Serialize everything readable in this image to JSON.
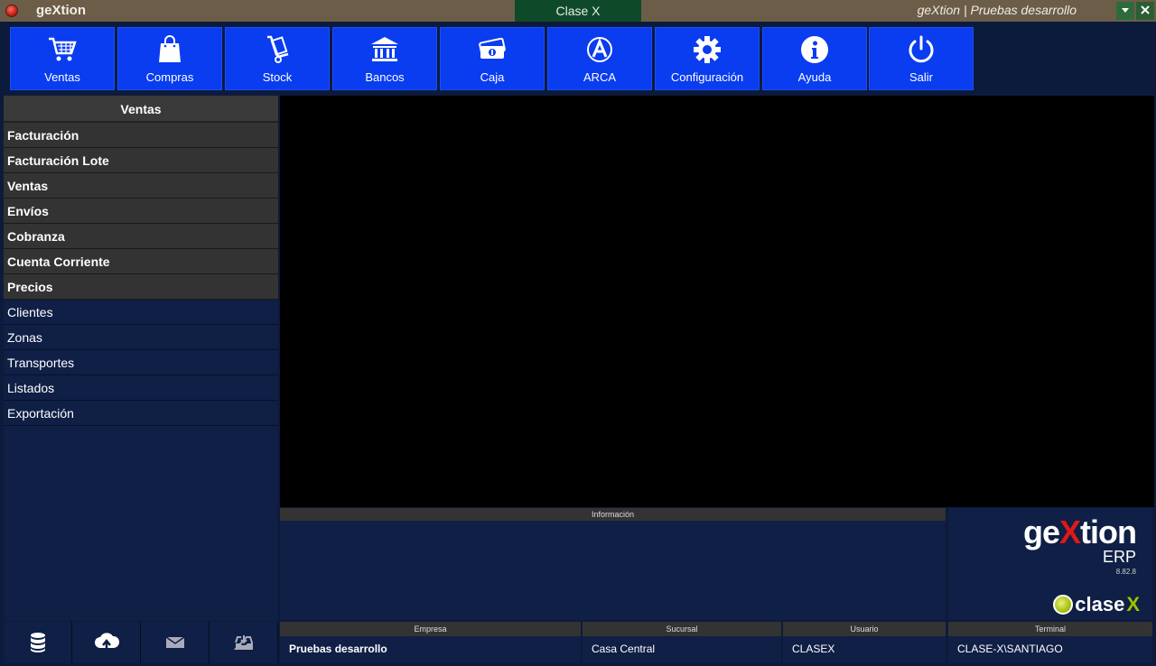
{
  "titlebar": {
    "app_name": "geXtion",
    "center_tab": "Clase X",
    "right_text": "geXtion | Pruebas desarrollo"
  },
  "toolbar": {
    "buttons": [
      {
        "label": "Ventas",
        "icon": "cart-icon"
      },
      {
        "label": "Compras",
        "icon": "shopping-bag-icon"
      },
      {
        "label": "Stock",
        "icon": "hand-truck-icon"
      },
      {
        "label": "Bancos",
        "icon": "bank-icon"
      },
      {
        "label": "Caja",
        "icon": "cash-icon"
      },
      {
        "label": "ARCA",
        "icon": "arca-icon"
      },
      {
        "label": "Configuración",
        "icon": "gear-icon"
      },
      {
        "label": "Ayuda",
        "icon": "info-icon"
      },
      {
        "label": "Salir",
        "icon": "power-icon"
      }
    ]
  },
  "sidebar": {
    "header": "Ventas",
    "items": [
      {
        "label": "Facturación"
      },
      {
        "label": "Facturación Lote"
      },
      {
        "label": "Ventas"
      },
      {
        "label": "Envíos"
      },
      {
        "label": "Cobranza"
      },
      {
        "label": "Cuenta Corriente"
      },
      {
        "label": "Precios"
      },
      {
        "label": "Clientes"
      },
      {
        "label": "Zonas"
      },
      {
        "label": "Transportes"
      },
      {
        "label": "Listados"
      },
      {
        "label": "Exportación"
      }
    ]
  },
  "info": {
    "header": "Información"
  },
  "logo": {
    "brand_pre": "ge",
    "brand_x": "X",
    "brand_post": "tion",
    "erp": "ERP",
    "version": "8.82.8",
    "company_pre": "clase",
    "company_x": "X"
  },
  "status": {
    "empresa": {
      "header": "Empresa",
      "value": "Pruebas desarrollo"
    },
    "sucursal": {
      "header": "Sucursal",
      "value": "Casa Central"
    },
    "usuario": {
      "header": "Usuario",
      "value": "CLASEX"
    },
    "terminal": {
      "header": "Terminal",
      "value": "CLASE-X\\SANTIAGO"
    }
  },
  "colors": {
    "toolbar_button": "#0a3cf0",
    "panel_bg": "#0f1f45",
    "titlebar_bg": "#6b5d48",
    "workspace_bg": "#000000"
  }
}
